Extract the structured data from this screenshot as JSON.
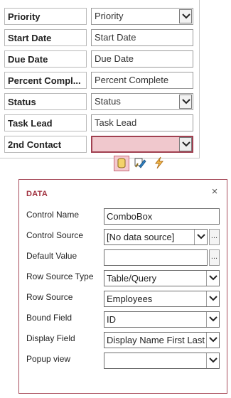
{
  "form": {
    "rows": [
      {
        "label": "Priority",
        "value": "Priority",
        "type": "combo"
      },
      {
        "label": "Start Date",
        "value": "Start Date",
        "type": "text"
      },
      {
        "label": "Due Date",
        "value": "Due Date",
        "type": "text"
      },
      {
        "label": "Percent Compl...",
        "value": "Percent Complete",
        "type": "text"
      },
      {
        "label": "Status",
        "value": "Status",
        "type": "combo"
      },
      {
        "label": "Task Lead",
        "value": "Task Lead",
        "type": "text"
      },
      {
        "label": "2nd Contact",
        "value": "",
        "type": "combo"
      }
    ]
  },
  "tools": [
    "data-icon",
    "format-icon",
    "actions-icon"
  ],
  "panel": {
    "title": "DATA",
    "close": "×",
    "fields": {
      "control_name": {
        "label": "Control Name",
        "value": "ComboBox"
      },
      "control_source": {
        "label": "Control Source",
        "value": "[No data source]",
        "button": "..."
      },
      "default_value": {
        "label": "Default Value",
        "value": "",
        "button": "..."
      },
      "row_source_type": {
        "label": "Row Source Type",
        "value": "Table/Query"
      },
      "row_source": {
        "label": "Row Source",
        "value": "Employees"
      },
      "bound_field": {
        "label": "Bound Field",
        "value": "ID"
      },
      "display_field": {
        "label": "Display Field",
        "value": "Display Name First Last"
      },
      "popup_view": {
        "label": "Popup view",
        "value": ""
      }
    }
  },
  "colors": {
    "accent": "#a84d5c",
    "selected_fill": "#f0c8cd"
  }
}
